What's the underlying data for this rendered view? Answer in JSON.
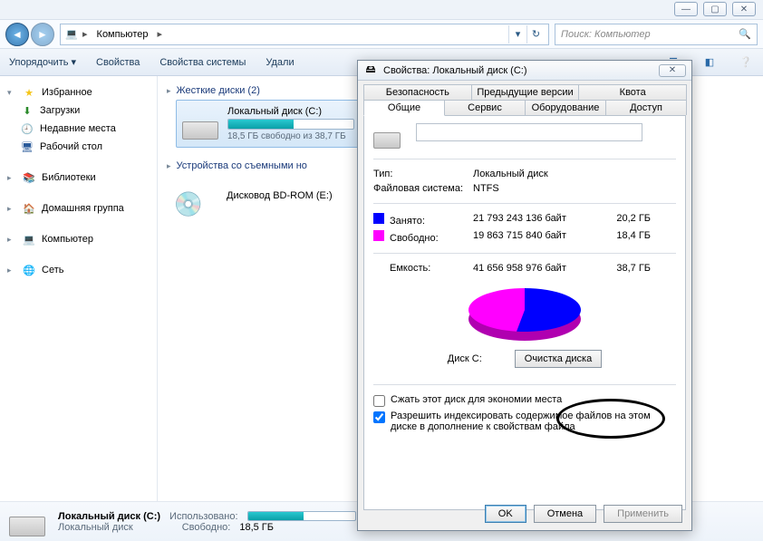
{
  "window_controls": {
    "min": "—",
    "max": "▢",
    "close": "✕"
  },
  "address": {
    "root_icon": "computer-icon",
    "root": "Компьютер",
    "crumb_tri": "▸",
    "dropdown": "▾",
    "refresh": "↻"
  },
  "search": {
    "placeholder": "Поиск: Компьютер"
  },
  "toolbar": {
    "organize": "Упорядочить ▾",
    "properties": "Свойства",
    "sys_properties": "Свойства системы",
    "uninstall": "Удали"
  },
  "sidebar": {
    "favorites": {
      "label": "Избранное",
      "items": [
        {
          "icon": "download-icon",
          "label": "Загрузки"
        },
        {
          "icon": "recent-icon",
          "label": "Недавние места"
        },
        {
          "icon": "desktop-icon",
          "label": "Рабочий стол"
        }
      ]
    },
    "libraries": {
      "label": "Библиотеки"
    },
    "homegroup": {
      "label": "Домашняя группа"
    },
    "computer": {
      "label": "Компьютер"
    },
    "network": {
      "label": "Сеть"
    }
  },
  "content": {
    "cat_hdd": "Жесткие диски (2)",
    "drive_c": {
      "name": "Локальный диск (C:)",
      "free_of": "18,5 ГБ свободно из 38,7 ГБ",
      "fill_pct": 52
    },
    "cat_removable": "Устройства со съемными но",
    "drive_e": {
      "name": "Дисковод BD-ROM (E:)"
    }
  },
  "details": {
    "name": "Локальный диск (C:)",
    "subtitle": "Локальный диск",
    "used_lbl": "Использовано:",
    "free_lbl": "Свободно:",
    "free_val": "18,5 ГБ"
  },
  "dialog": {
    "title": "Свойства: Локальный диск (C:)",
    "tabs_row1": [
      "Безопасность",
      "Предыдущие версии",
      "Квота"
    ],
    "tabs_row2": [
      "Общие",
      "Сервис",
      "Оборудование",
      "Доступ"
    ],
    "active_tab": "Общие",
    "name_value": "",
    "type_lbl": "Тип:",
    "type_val": "Локальный диск",
    "fs_lbl": "Файловая система:",
    "fs_val": "NTFS",
    "used_lbl": "Занято:",
    "used_bytes": "21 793 243 136 байт",
    "used_gb": "20,2 ГБ",
    "used_color": "#0000ff",
    "free_lbl": "Свободно:",
    "free_bytes": "19 863 715 840 байт",
    "free_gb": "18,4 ГБ",
    "free_color": "#ff00ff",
    "cap_lbl": "Емкость:",
    "cap_bytes": "41 656 958 976 байт",
    "cap_gb": "38,7 ГБ",
    "disk_label": "Диск C:",
    "cleanup": "Очистка диска",
    "compress": "Сжать этот диск для экономии места",
    "index": "Разрешить индексировать содержимое файлов на этом диске в дополнение к свойствам файла",
    "index_checked": true,
    "compress_checked": false,
    "ok": "OK",
    "cancel": "Отмена",
    "apply": "Применить"
  },
  "chart_data": {
    "type": "pie",
    "title": "Диск C:",
    "series": [
      {
        "name": "Занято",
        "value": 21793243136,
        "value_gb": 20.2,
        "color": "#0000ff"
      },
      {
        "name": "Свободно",
        "value": 19863715840,
        "value_gb": 18.4,
        "color": "#ff00ff"
      }
    ],
    "total": 41656958976,
    "total_gb": 38.7
  }
}
